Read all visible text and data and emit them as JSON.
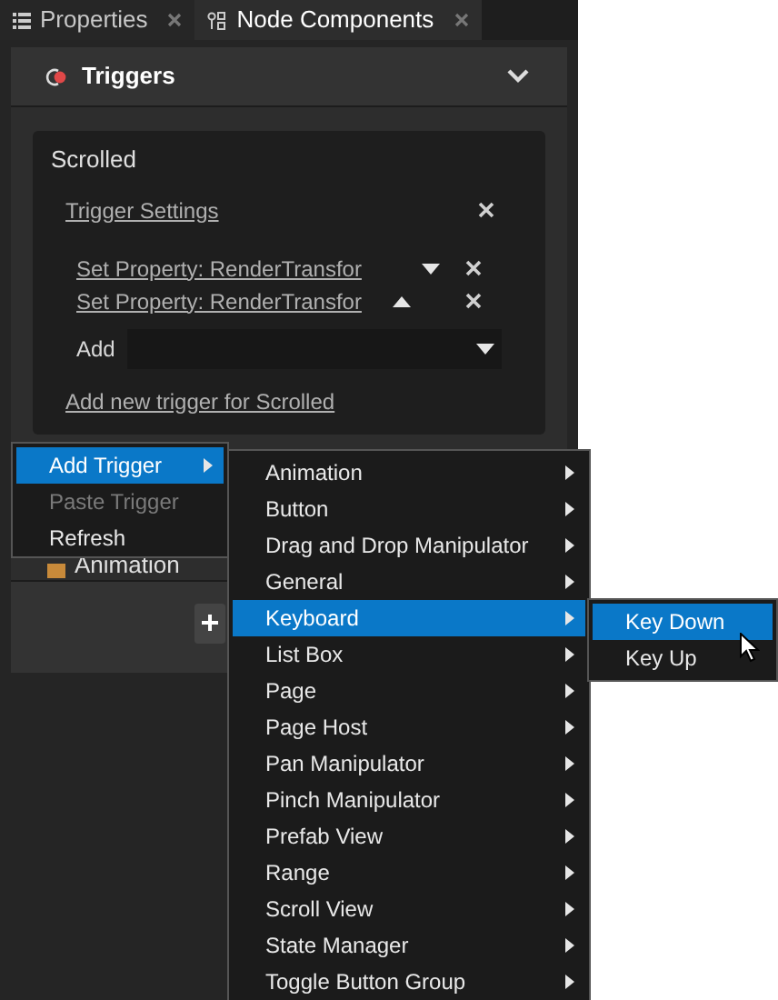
{
  "tabs": [
    {
      "label": "Properties",
      "selected": false
    },
    {
      "label": "Node Components",
      "selected": true
    }
  ],
  "section": {
    "title": "Triggers",
    "expanded": true
  },
  "trigger_card": {
    "event": "Scrolled",
    "settings_link": "Trigger Settings",
    "actions": [
      {
        "label": "Set Property: RenderTransfor",
        "kind": "move_down"
      },
      {
        "label": "Set Property: RenderTransfor",
        "kind": "move_up"
      }
    ],
    "add_label": "Add",
    "add_trigger_link": "Add new trigger for Scrolled"
  },
  "behind_item": {
    "label": "Animation"
  },
  "context_menu": [
    {
      "label": "Add Trigger",
      "selected": true,
      "disabled": false,
      "submenu": true
    },
    {
      "label": "Paste Trigger",
      "selected": false,
      "disabled": true,
      "submenu": false
    },
    {
      "label": "Refresh",
      "selected": false,
      "disabled": false,
      "submenu": false
    }
  ],
  "trigger_types": [
    {
      "label": "Animation",
      "selected": false
    },
    {
      "label": "Button",
      "selected": false
    },
    {
      "label": "Drag and Drop Manipulator",
      "selected": false
    },
    {
      "label": "General",
      "selected": false
    },
    {
      "label": "Keyboard",
      "selected": true
    },
    {
      "label": "List Box",
      "selected": false
    },
    {
      "label": "Page",
      "selected": false
    },
    {
      "label": "Page Host",
      "selected": false
    },
    {
      "label": "Pan Manipulator",
      "selected": false
    },
    {
      "label": "Pinch Manipulator",
      "selected": false
    },
    {
      "label": "Prefab View",
      "selected": false
    },
    {
      "label": "Range",
      "selected": false
    },
    {
      "label": "Scroll View",
      "selected": false
    },
    {
      "label": "State Manager",
      "selected": false
    },
    {
      "label": "Toggle Button Group",
      "selected": false
    }
  ],
  "keyboard_triggers": [
    {
      "label": "Key Down",
      "selected": true
    },
    {
      "label": "Key Up",
      "selected": false
    }
  ]
}
